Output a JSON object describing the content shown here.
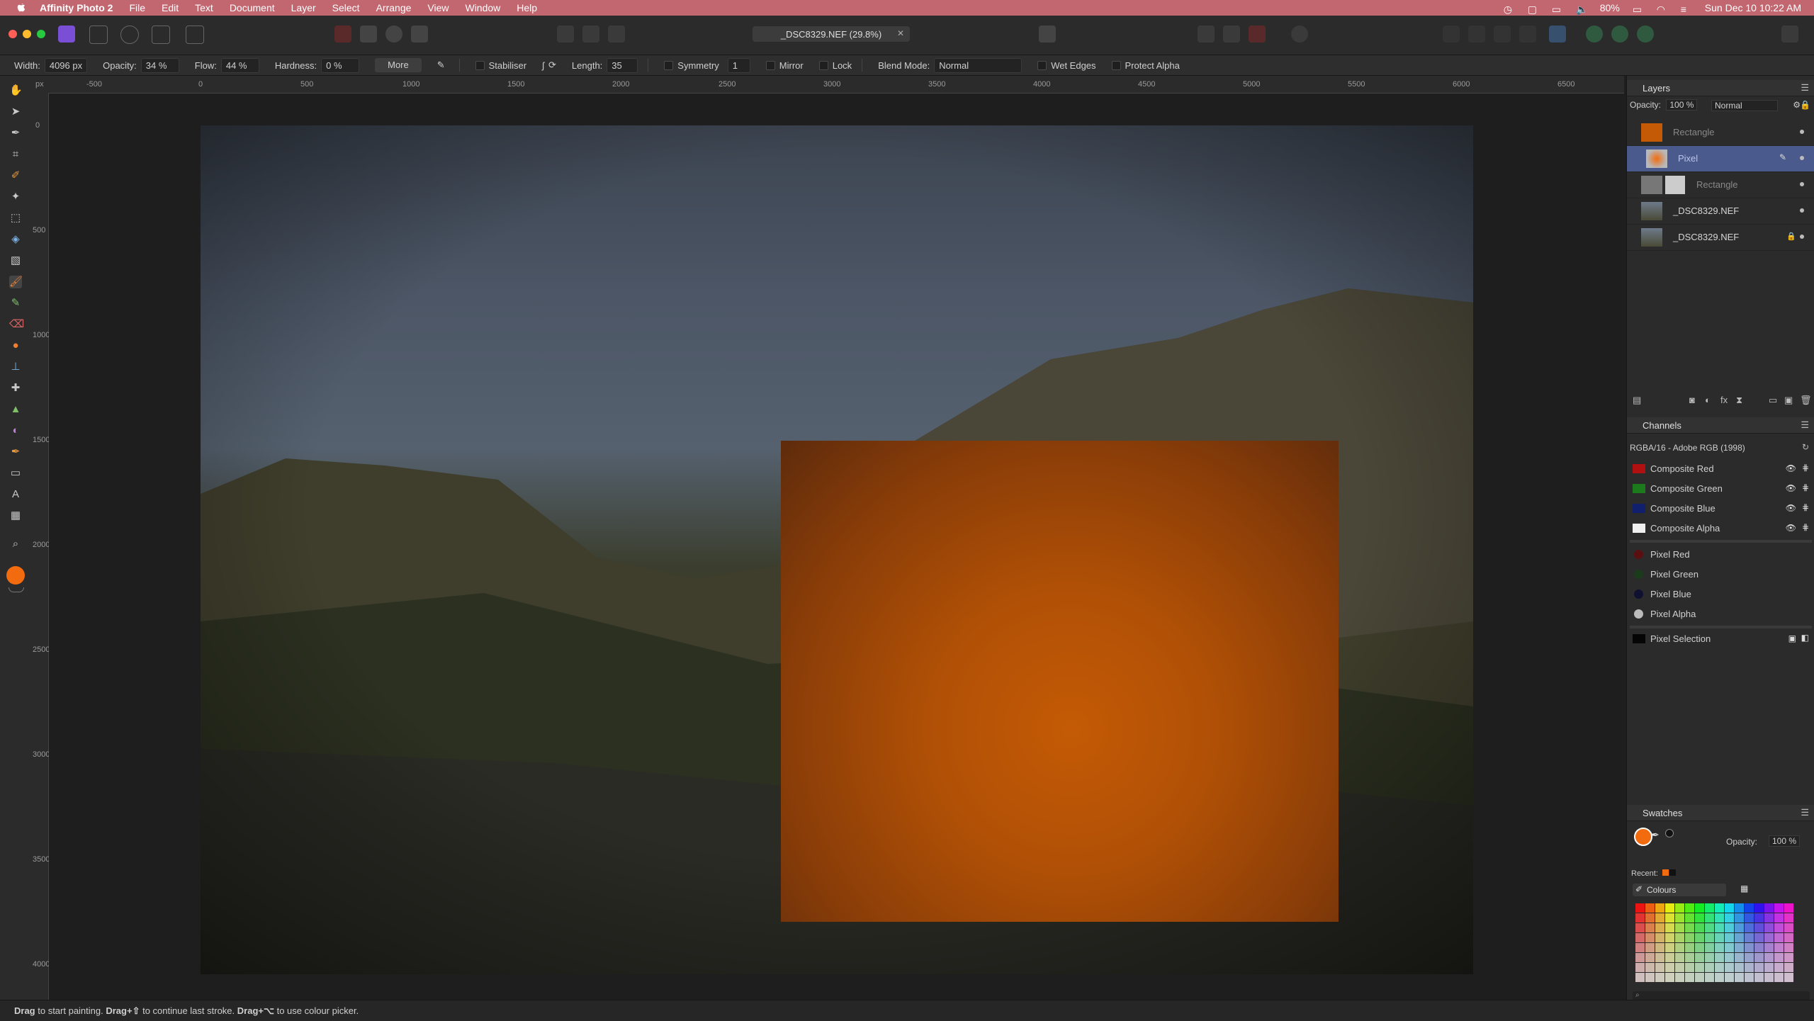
{
  "menubar": {
    "app_name": "Affinity Photo 2",
    "items": [
      "File",
      "Edit",
      "Text",
      "Document",
      "Layer",
      "Select",
      "Arrange",
      "View",
      "Window",
      "Help"
    ],
    "battery": "80%",
    "datetime": "Sun Dec 10  10:22 AM"
  },
  "document": {
    "tab_title": "_DSC8329.NEF (29.8%)"
  },
  "context_toolbar": {
    "width_label": "Width:",
    "width_value": "4096 px",
    "opacity_label": "Opacity:",
    "opacity_value": "34 %",
    "flow_label": "Flow:",
    "flow_value": "44 %",
    "hardness_label": "Hardness:",
    "hardness_value": "0 %",
    "more_label": "More",
    "stabiliser_label": "Stabiliser",
    "length_label": "Length:",
    "length_value": "35",
    "symmetry_label": "Symmetry",
    "symmetry_value": "1",
    "mirror_label": "Mirror",
    "lock_label": "Lock",
    "blend_mode_label": "Blend Mode:",
    "blend_mode_value": "Normal",
    "wet_edges_label": "Wet Edges",
    "protect_alpha_label": "Protect Alpha"
  },
  "rulers": {
    "unit": "px",
    "top_ticks": [
      "-500",
      "0",
      "500",
      "1000",
      "1500",
      "2000",
      "2500",
      "3000",
      "3500",
      "4000",
      "4500",
      "5000",
      "5500",
      "6000",
      "6500"
    ],
    "left_ticks": [
      "0",
      "500",
      "1000",
      "1500",
      "2000",
      "2500",
      "3000",
      "3500",
      "4000"
    ]
  },
  "layers_panel": {
    "title": "Layers",
    "opacity_label": "Opacity:",
    "opacity_value": "100 %",
    "blend_value": "Normal",
    "layers": [
      {
        "name": "Rectangle",
        "selected": false
      },
      {
        "name": "Pixel",
        "selected": true
      },
      {
        "name": "Rectangle",
        "selected": false
      },
      {
        "name": "_DSC8329.NEF",
        "selected": false
      },
      {
        "name": "_DSC8329.NEF",
        "selected": false
      }
    ]
  },
  "channels_panel": {
    "title": "Channels",
    "color_profile": "RGBA/16 - Adobe RGB (1998)",
    "composite": [
      "Composite Red",
      "Composite Green",
      "Composite Blue",
      "Composite Alpha"
    ],
    "pixel": [
      "Pixel Red",
      "Pixel Green",
      "Pixel Blue",
      "Pixel Alpha"
    ],
    "selection": "Pixel Selection"
  },
  "swatches_panel": {
    "title": "Swatches",
    "opacity_label": "Opacity:",
    "opacity_value": "100 %",
    "recent_label": "Recent:",
    "palette_name": "Colours",
    "primary_color": "#f26b0f"
  },
  "statusbar": {
    "a1": "Drag",
    "t1": " to start painting. ",
    "a2": "Drag+⇧",
    "t2": " to continue last stroke. ",
    "a3": "Drag+⌥",
    "t3": " to use colour picker."
  }
}
